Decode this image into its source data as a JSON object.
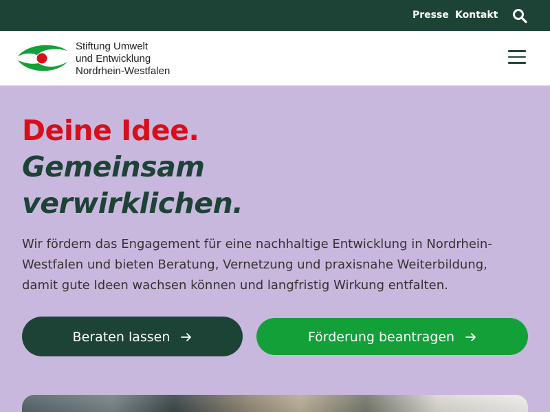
{
  "topbar": {
    "links": [
      {
        "label": "Presse"
      },
      {
        "label": "Kontakt"
      }
    ],
    "search_icon": "search-icon"
  },
  "header": {
    "logo_lines": [
      "Stiftung Umwelt",
      "und Entwicklung",
      "Nordrhein-Westfalen"
    ],
    "menu_icon": "hamburger-icon"
  },
  "hero": {
    "headline": [
      "Deine Idee.",
      "Gemeinsam",
      "verwirklichen."
    ],
    "intro": "Wir fördern das Engagement für eine nachhaltige Entwicklung in Nordrhein-Westfalen und bieten Beratung, Vernetzung und praxisnahe Weiterbildung, damit gute Ideen wachsen können und langfristig Wirkung entfalten.",
    "buttons": [
      {
        "label": "Beraten lassen",
        "icon": "arrow-right-icon"
      },
      {
        "label": "Förderung beantragen",
        "icon": "arrow-right-icon"
      }
    ]
  },
  "colors": {
    "dark_green": "#1d4337",
    "bright_green": "#14a038",
    "red": "#d80e1b",
    "lavender": "#c9b8dd"
  }
}
